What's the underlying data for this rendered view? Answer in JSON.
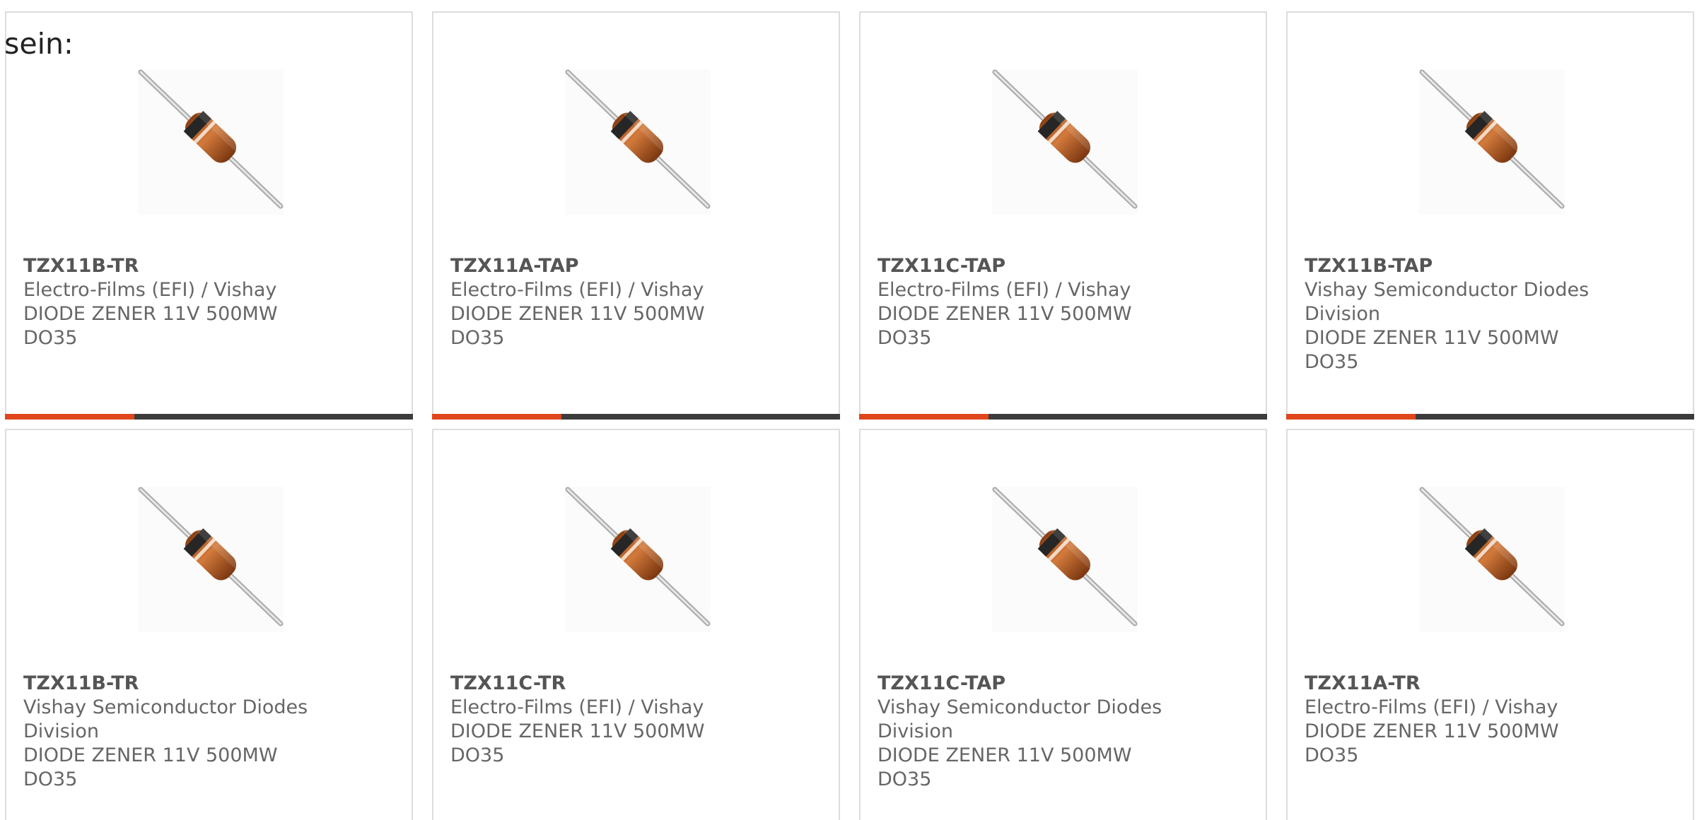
{
  "intro_text": "sein:",
  "colors": {
    "accent_bar": "#e0461c",
    "dark_bar": "#3c3c3c",
    "card_border": "#dddddd",
    "text": "#666666"
  },
  "products": [
    {
      "part_number": "TZX11B-TR",
      "manufacturer": "Electro-Films (EFI) / Vishay",
      "description": "DIODE ZENER 11V 500MW DO35",
      "image_icon": "diode-do35-icon"
    },
    {
      "part_number": "TZX11A-TAP",
      "manufacturer": "Electro-Films (EFI) / Vishay",
      "description": "DIODE ZENER 11V 500MW DO35",
      "image_icon": "diode-do35-icon"
    },
    {
      "part_number": "TZX11C-TAP",
      "manufacturer": "Electro-Films (EFI) / Vishay",
      "description": "DIODE ZENER 11V 500MW DO35",
      "image_icon": "diode-do35-icon"
    },
    {
      "part_number": "TZX11B-TAP",
      "manufacturer": "Vishay Semiconductor Diodes Division",
      "description": "DIODE ZENER 11V 500MW DO35",
      "image_icon": "diode-do35-icon"
    },
    {
      "part_number": "TZX11B-TR",
      "manufacturer": "Vishay Semiconductor Diodes Division",
      "description": "DIODE ZENER 11V 500MW DO35",
      "image_icon": "diode-do35-icon"
    },
    {
      "part_number": "TZX11C-TR",
      "manufacturer": "Electro-Films (EFI) / Vishay",
      "description": "DIODE ZENER 11V 500MW DO35",
      "image_icon": "diode-do35-icon"
    },
    {
      "part_number": "TZX11C-TAP",
      "manufacturer": "Vishay Semiconductor Diodes Division",
      "description": "DIODE ZENER 11V 500MW DO35",
      "image_icon": "diode-do35-icon"
    },
    {
      "part_number": "TZX11A-TR",
      "manufacturer": "Electro-Films (EFI) / Vishay",
      "description": "DIODE ZENER 11V 500MW DO35",
      "image_icon": "diode-do35-icon"
    }
  ]
}
